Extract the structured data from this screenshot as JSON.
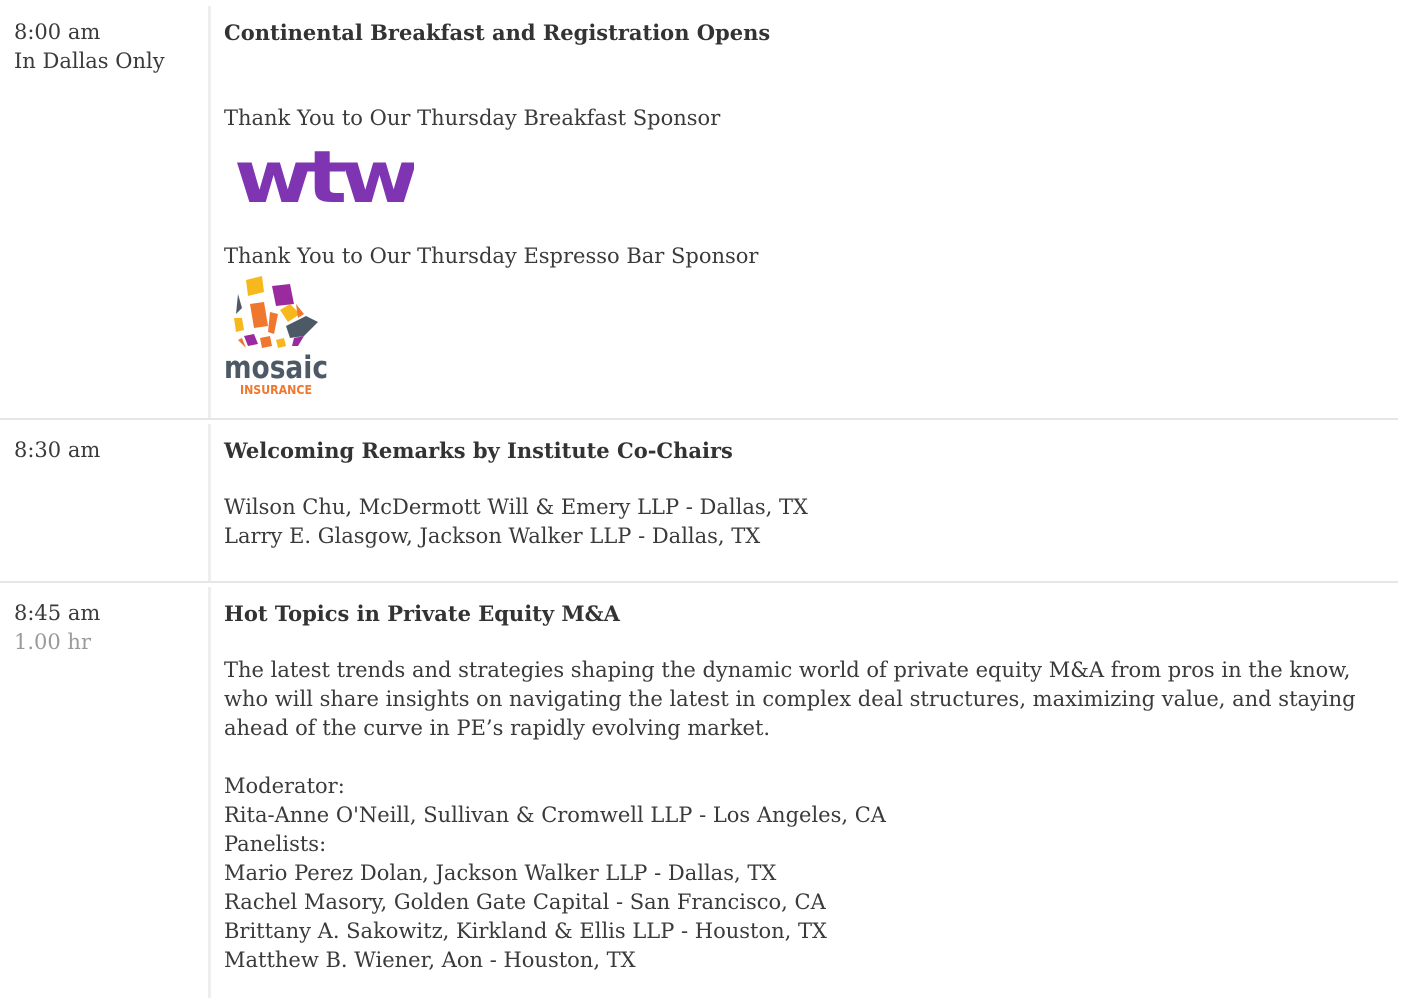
{
  "sessions": [
    {
      "time": "8:00 am",
      "note": "In Dallas Only",
      "title": "Continental Breakfast and Registration Opens",
      "sponsor1_label": "Thank You to Our Thursday Breakfast Sponsor",
      "sponsor1_logo": "wtw",
      "sponsor2_label": "Thank You to Our Thursday Espresso Bar Sponsor",
      "sponsor2_logo_word": "mosaic",
      "sponsor2_logo_sub": "INSURANCE"
    },
    {
      "time": "8:30 am",
      "title": "Welcoming Remarks by Institute Co-Chairs",
      "speakers": [
        "Wilson Chu, McDermott Will & Emery LLP - Dallas, TX",
        "Larry E. Glasgow, Jackson Walker LLP - Dallas, TX"
      ]
    },
    {
      "time": "8:45 am",
      "duration": "1.00 hr",
      "title": "Hot Topics in Private Equity M&A",
      "description": "The latest trends and strategies shaping the dynamic world of private equity M&A from pros in the know, who will share insights on navigating the latest in complex deal structures, maximizing value, and staying ahead of the curve in PE’s rapidly evolving market.",
      "moderator_label": "Moderator:",
      "moderator": "Rita-Anne O'Neill, Sullivan & Cromwell LLP - Los Angeles, CA",
      "panelists_label": "Panelists:",
      "panelists": [
        "Mario Perez Dolan, Jackson Walker LLP - Dallas, TX",
        "Rachel Masory, Golden Gate Capital - San Francisco, CA",
        "Brittany A. Sakowitz, Kirkland & Ellis LLP - Houston, TX",
        "Matthew B. Wiener, Aon - Houston, TX"
      ]
    }
  ],
  "colors": {
    "text": "#3a3a3a",
    "muted": "#9a9a9a",
    "divider": "#e6e6e6",
    "wtw_purple": "#7f35b2",
    "mosaic_gray": "#4d5a66",
    "mosaic_orange": "#f0772e"
  }
}
